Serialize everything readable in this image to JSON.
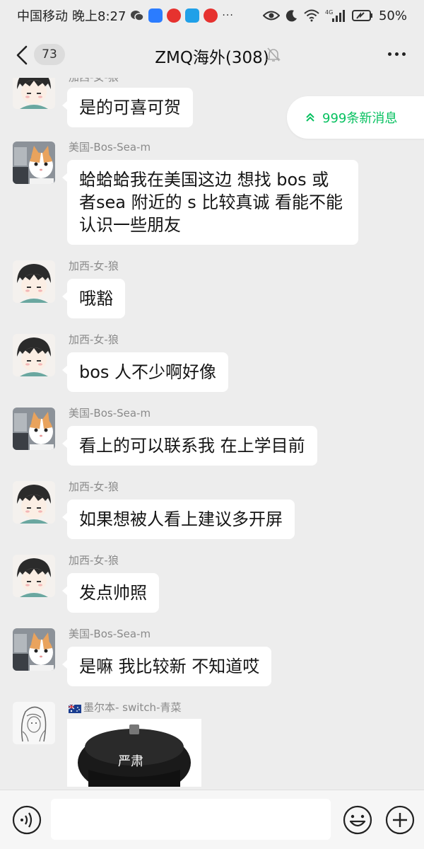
{
  "status_bar": {
    "carrier": "中国移动",
    "time": "晚上8:27",
    "more": "···",
    "network": "4G",
    "battery": "50%"
  },
  "nav": {
    "unread_count": "73",
    "title": "ZMQ海外(308)"
  },
  "new_messages_pill": {
    "label": "999条新消息",
    "accent": "#07c160"
  },
  "messages": [
    {
      "sender": "加西-女-狼",
      "text": "是的可喜可贺",
      "avatar": "anime-boy-avatar"
    },
    {
      "sender": "美国-Bos-Sea-m",
      "lines": [
        "蛤蛤蛤我在美国这边 想找 bos 或",
        "者sea 附近的 s 比较真诚 看能不能",
        "认识一些朋友"
      ],
      "avatar": "cat-avatar"
    },
    {
      "sender": "加西-女-狼",
      "text": "哦豁",
      "avatar": "anime-boy-avatar"
    },
    {
      "sender": "加西-女-狼",
      "text": "bos 人不少啊好像",
      "avatar": "anime-boy-avatar"
    },
    {
      "sender": "美国-Bos-Sea-m",
      "text": "看上的可以联系我 在上学目前",
      "avatar": "cat-avatar"
    },
    {
      "sender": "加西-女-狼",
      "text": "如果想被人看上建议多开屏",
      "avatar": "anime-boy-avatar"
    },
    {
      "sender": "加西-女-狼",
      "text": "发点帅照",
      "avatar": "anime-boy-avatar"
    },
    {
      "sender": "美国-Bos-Sea-m",
      "text": "是嘛 我比较新 不知道哎",
      "avatar": "cat-avatar"
    },
    {
      "sender": "墨尔本- switch-青菜",
      "sticker_text": "严肃",
      "avatar": "sketch-girl-avatar"
    }
  ],
  "colors": {
    "background": "#ededed",
    "bubble": "#ffffff",
    "sender": "#8a8a8a"
  }
}
